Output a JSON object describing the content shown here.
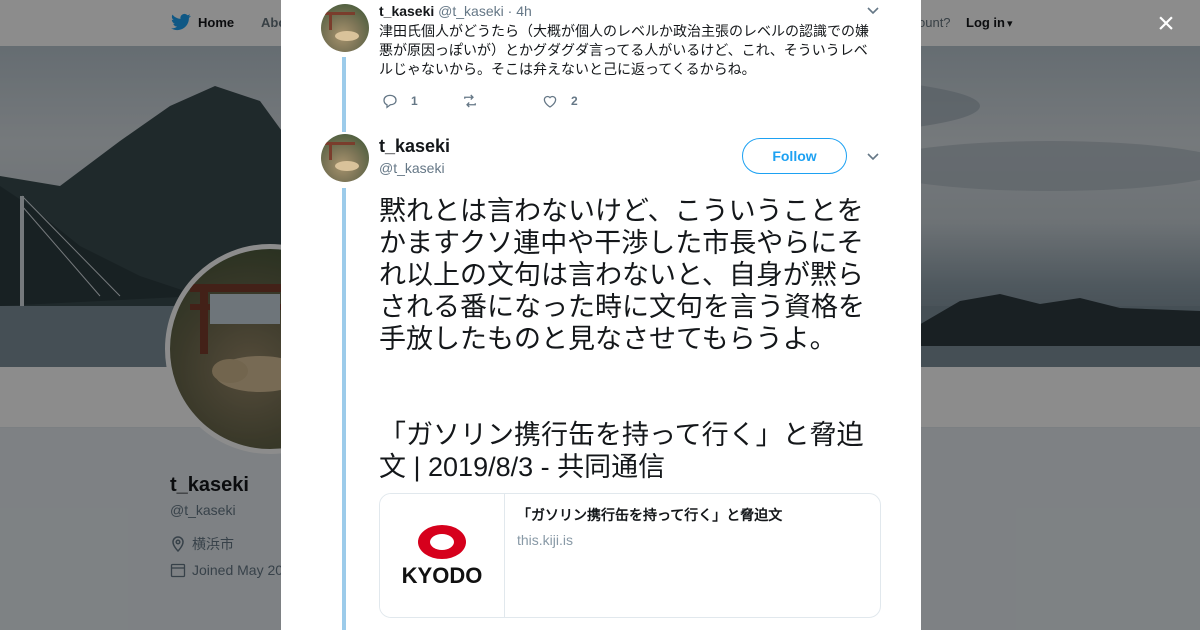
{
  "background": {
    "nav": {
      "home_label": "Home",
      "about_label": "Abo",
      "account_text": "ccount?",
      "login_label": "Log in"
    },
    "profile": {
      "name": "t_kaseki",
      "handle": "@t_kaseki",
      "location": "横浜市",
      "joined": "Joined May 20"
    }
  },
  "modal": {
    "close_label": "×",
    "tweet1": {
      "name": "t_kaseki",
      "handle": "@t_kaseki",
      "time": "· 4h",
      "text": "津田氏個人がどうたら（大概が個人のレベルか政治主張のレベルの認識での嫌悪が原因っぽいが）とかグダグダ言ってる人がいるけど、これ、そういうレベルじゃないから。そこは弁えないと己に返ってくるからね。",
      "reply_count": "1",
      "retweet_count": "",
      "like_count": "2"
    },
    "tweet2": {
      "name": "t_kaseki",
      "handle": "@t_kaseki",
      "follow_label": "Follow",
      "body": "黙れとは言わないけど、こういうことをかますクソ連中や干渉した市長やらにそれ以上の文句は言わないと、自身が黙らされる番になった時に文句を言う資格を手放したものと見なさせてもらうよ。",
      "link_title": "「ガソリン携行缶を持って行く」と脅迫文 | 2019/8/3 - 共同通信",
      "card": {
        "logo_text": "KYODO",
        "title": "「ガソリン携行缶を持って行く」と脅迫文",
        "domain": "this.kiji.is"
      }
    }
  },
  "colors": {
    "accent": "#1da1f2",
    "thread_line": "#9ccbea",
    "kyodo_red": "#d6001c"
  }
}
